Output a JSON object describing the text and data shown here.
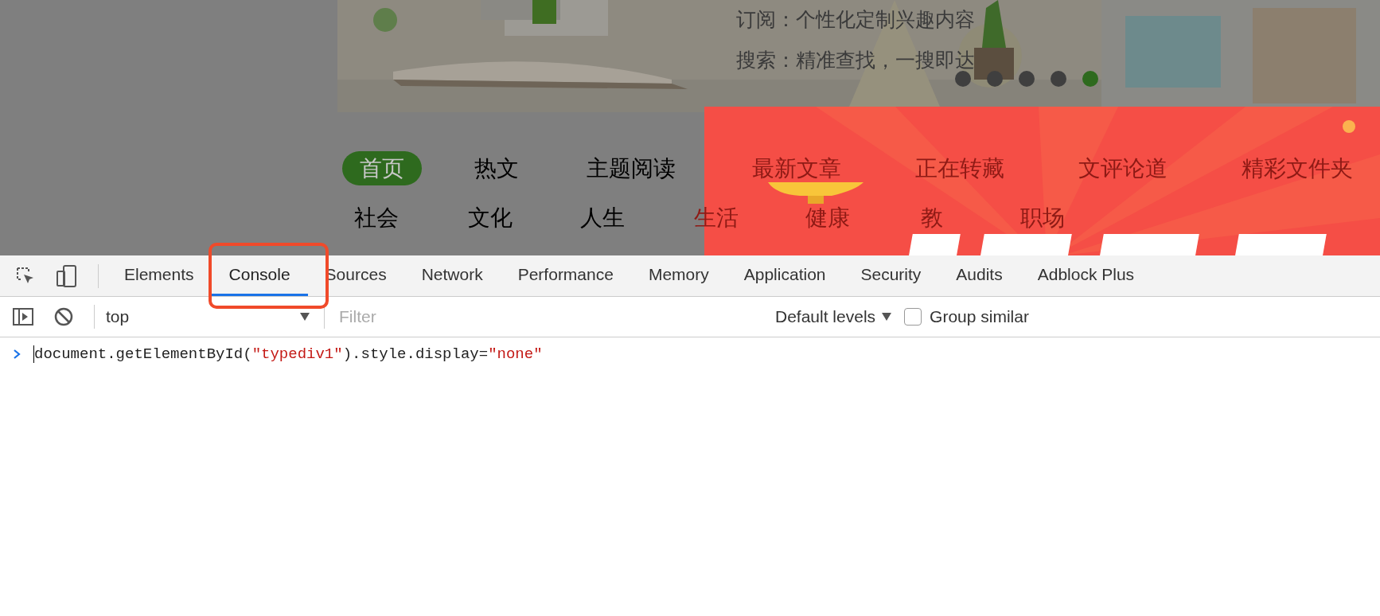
{
  "page": {
    "banner": {
      "lines": [
        "订阅：个性化定制兴趣内容",
        "搜索：精准查找，一搜即达"
      ],
      "dots": [
        {
          "selected": false
        },
        {
          "selected": false
        },
        {
          "selected": false
        },
        {
          "selected": false
        },
        {
          "selected": true
        }
      ]
    },
    "nav_rows": [
      [
        {
          "label": "首页",
          "selected": true,
          "covered": false
        },
        {
          "label": "热文",
          "selected": false,
          "covered": false
        },
        {
          "label": "主题阅读",
          "selected": false,
          "covered": false
        },
        {
          "label": "最新文章",
          "selected": false,
          "covered": true
        },
        {
          "label": "正在转藏",
          "selected": false,
          "covered": true
        },
        {
          "label": "文评论道",
          "selected": false,
          "covered": true
        },
        {
          "label": "精彩文件夹",
          "selected": false,
          "covered": true
        }
      ],
      [
        {
          "label": "社会",
          "selected": false,
          "covered": false
        },
        {
          "label": "文化",
          "selected": false,
          "covered": false
        },
        {
          "label": "人生",
          "selected": false,
          "covered": false
        },
        {
          "label": "生活",
          "selected": false,
          "covered": true
        },
        {
          "label": "健康",
          "selected": false,
          "covered": true
        },
        {
          "label": "教",
          "selected": false,
          "covered": true
        },
        {
          "label": "职场",
          "selected": false,
          "covered": true
        }
      ]
    ]
  },
  "devtools": {
    "tabs": [
      {
        "label": "Elements",
        "selected": false,
        "highlighted": false
      },
      {
        "label": "Console",
        "selected": true,
        "highlighted": true
      },
      {
        "label": "Sources",
        "selected": false,
        "highlighted": false
      },
      {
        "label": "Network",
        "selected": false,
        "highlighted": false
      },
      {
        "label": "Performance",
        "selected": false,
        "highlighted": false
      },
      {
        "label": "Memory",
        "selected": false,
        "highlighted": false
      },
      {
        "label": "Application",
        "selected": false,
        "highlighted": false
      },
      {
        "label": "Security",
        "selected": false,
        "highlighted": false
      },
      {
        "label": "Audits",
        "selected": false,
        "highlighted": false
      },
      {
        "label": "Adblock Plus",
        "selected": false,
        "highlighted": false
      }
    ],
    "toolbar": {
      "context": "top",
      "filter": {
        "placeholder": "Filter"
      },
      "levels": "Default levels",
      "group_similar": {
        "label": "Group similar",
        "checked": false
      }
    },
    "console": {
      "lines": [
        {
          "tokens": [
            {
              "kind": "code",
              "text": "document.getElementById("
            },
            {
              "kind": "string",
              "text": "\"typediv1\""
            },
            {
              "kind": "code",
              "text": ").style.display="
            },
            {
              "kind": "string",
              "text": "\"none\""
            }
          ]
        }
      ]
    }
  }
}
